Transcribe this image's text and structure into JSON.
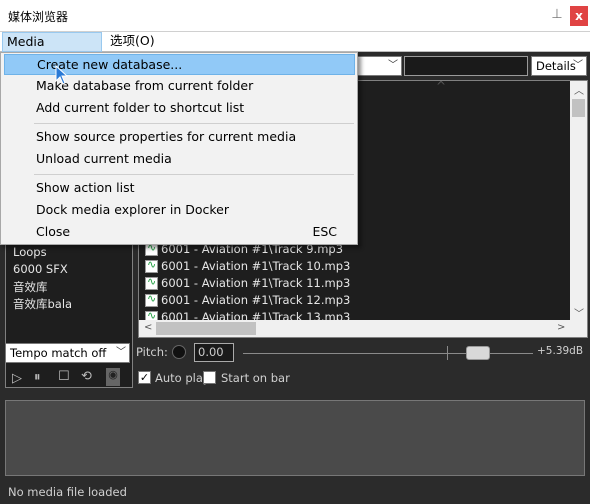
{
  "window": {
    "title": "媒体浏览器",
    "pin_glyph": "⊥",
    "close_glyph": "x"
  },
  "menubar": {
    "items": [
      "Media Explorer",
      "选项(O)"
    ]
  },
  "dropdown_menu": {
    "items": [
      {
        "label": "Create new database...",
        "shortcut": ""
      },
      {
        "label": "Make database from current folder",
        "shortcut": ""
      },
      {
        "label": "Add current folder to shortcut list",
        "shortcut": ""
      },
      {
        "label": "Show source properties for current media",
        "shortcut": ""
      },
      {
        "label": "Unload current media",
        "shortcut": ""
      },
      {
        "label": "Show action list",
        "shortcut": ""
      },
      {
        "label": "Dock media explorer in Docker",
        "shortcut": ""
      },
      {
        "label": "Close",
        "shortcut": "ESC"
      }
    ]
  },
  "toolbar": {
    "view_mode": "Details"
  },
  "folders": [
    "Loops",
    "6000 SFX",
    "音效库",
    "音效库bala"
  ],
  "files": [
    "6001 - Aviation #1\\Track  9.mp3",
    "6001 - Aviation #1\\Track 10.mp3",
    "6001 - Aviation #1\\Track 11.mp3",
    "6001 - Aviation #1\\Track 12.mp3",
    "6001 - Aviation #1\\Track 13.mp3"
  ],
  "playback": {
    "tempo_mode": "Tempo match off",
    "pitch_label": "Pitch:",
    "pitch_value": "0.00",
    "volume": "+5.39dB",
    "autoplay_label": "Auto play",
    "autoplay_checked": true,
    "start_on_bar_label": "Start on bar",
    "start_on_bar_checked": false
  },
  "status": "No media file loaded"
}
